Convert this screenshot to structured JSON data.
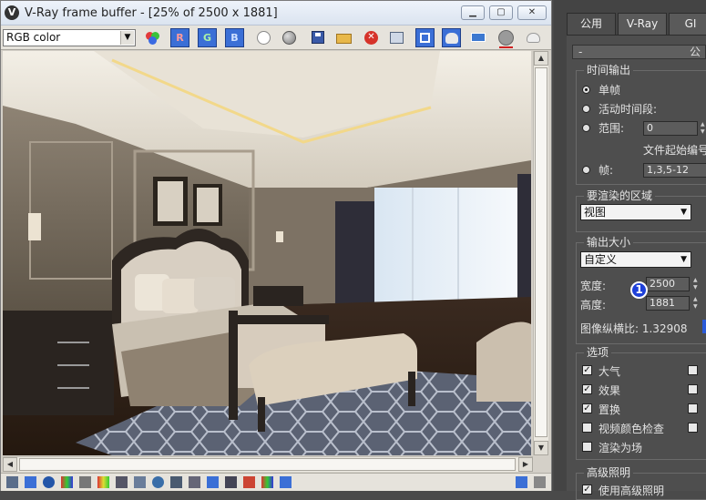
{
  "vfb": {
    "title": "V-Ray frame buffer - [25% of 2500 x 1881]",
    "logo_icon": "vray-logo-icon",
    "channel": "RGB color",
    "r_label": "R",
    "g_label": "G",
    "b_label": "B",
    "minimize_glyph": "▁",
    "maximize_glyph": "▢",
    "close_glyph": "✕"
  },
  "render_setup": {
    "tabs": [
      "公用",
      "V-Ray",
      "GI"
    ],
    "rollout_title": "-",
    "rollout_title_right": "公",
    "time_output": {
      "title": "时间输出",
      "single": "单帧",
      "active_segment": "活动时间段:",
      "range": "范围:",
      "range_start": "0",
      "file_number_label": "文件起始编号",
      "frames": "帧:",
      "frames_value": "1,3,5-12"
    },
    "area": {
      "title": "要渲染的区域",
      "value": "视图"
    },
    "output_size": {
      "title": "输出大小",
      "preset": "自定义",
      "width_label": "宽度:",
      "width": "2500",
      "height_label": "高度:",
      "height": "1881",
      "aspect_label": "图像纵横比: 1.32908"
    },
    "options": {
      "title": "选项",
      "atmospherics": "大气",
      "effects": "效果",
      "displacement": "置换",
      "video_check": "视频颜色检查",
      "render_to_fields": "渲染为场"
    },
    "adv_lighting": {
      "title": "高级照明",
      "use": "使用高级照明"
    },
    "badge": "1"
  }
}
